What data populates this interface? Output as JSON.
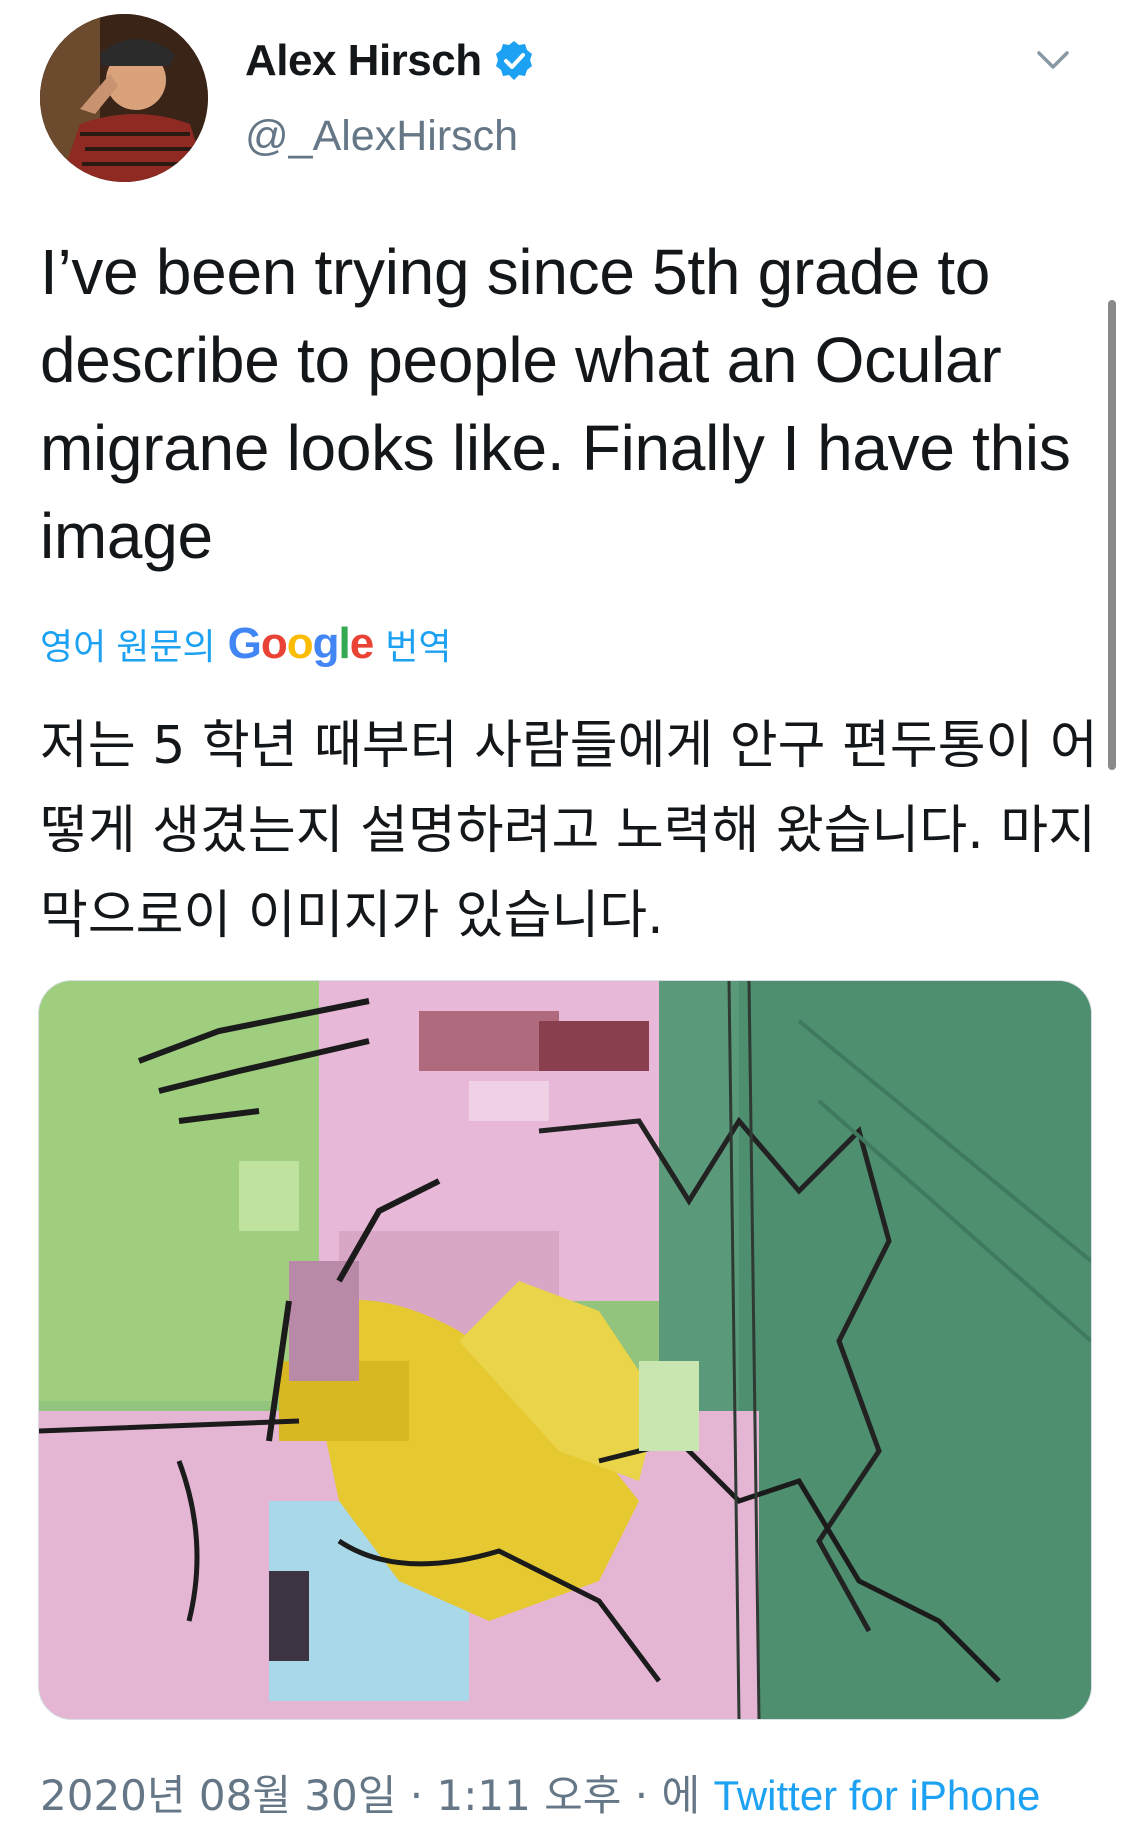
{
  "author": {
    "display_name": "Alex Hirsch",
    "handle": "@_AlexHirsch",
    "verified": true
  },
  "tweet": {
    "text": "I’ve been trying since 5th grade to describe to people what an Ocular migrane looks like. Finally I have this image",
    "translate": {
      "prefix": "영어 원문의",
      "brand": "Google",
      "suffix": "번역"
    },
    "translated_text": "저는 5 학년 때부터 사람들에게 안구 편두통이 어떻게 생겼는지 설명하려고 노력해 왔습니다. 마지막으로이 이미지가 있습니다."
  },
  "footer": {
    "date": "2020년 08월 30일",
    "time": "1:11 오후",
    "via": "에",
    "client": "Twitter for iPhone"
  },
  "icons": {
    "verified": "verified-badge-icon",
    "menu": "chevron-down-icon"
  },
  "colors": {
    "accent": "#1da1f2",
    "secondary_text": "#657786"
  }
}
